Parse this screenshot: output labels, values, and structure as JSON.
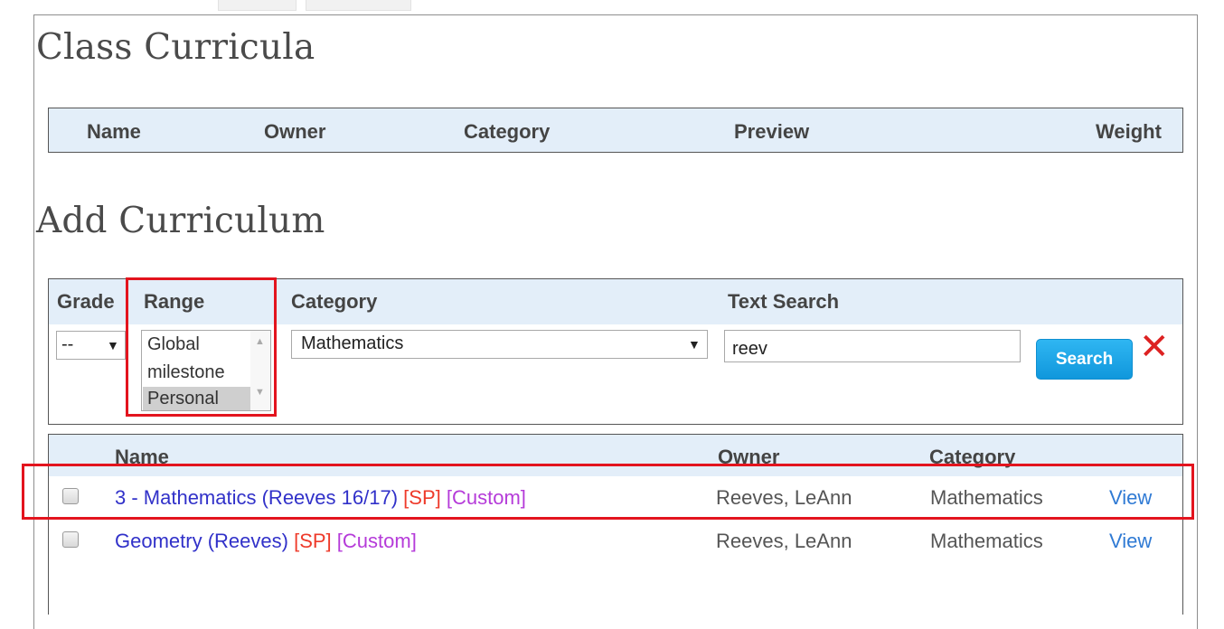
{
  "page": {
    "title": "Class Curricula",
    "add_title": "Add Curriculum"
  },
  "curricula_table": {
    "columns": [
      "Name",
      "Owner",
      "Category",
      "Preview",
      "Weight"
    ]
  },
  "filters": {
    "labels": {
      "grade": "Grade",
      "range": "Range",
      "category": "Category",
      "text_search": "Text Search"
    },
    "grade_value": "--",
    "range_options": [
      "Global",
      "milestone",
      "Personal"
    ],
    "range_selected": "Personal",
    "category_value": "Mathematics",
    "text_search_value": "reev",
    "search_button": "Search"
  },
  "results": {
    "columns": [
      "Name",
      "Owner",
      "Category"
    ],
    "rows": [
      {
        "name": "3 - Mathematics (Reeves 16/17)",
        "sp": "[SP]",
        "custom": "[Custom]",
        "owner": "Reeves, LeAnn",
        "category": "Mathematics",
        "action": "View"
      },
      {
        "name": "Geometry (Reeves)",
        "sp": "[SP]",
        "custom": "[Custom]",
        "owner": "Reeves, LeAnn",
        "category": "Mathematics",
        "action": "View"
      }
    ]
  },
  "icons": {
    "clear": "close-icon",
    "dropdown": "chevron-down-icon"
  },
  "colors": {
    "header_bg": "#e3eef9",
    "link": "#3131c9",
    "sp": "#ee3a2a",
    "custom": "#b53bd9",
    "view": "#2f7ad4",
    "highlight": "#e3141e",
    "search_button": "#1aa7ea"
  }
}
